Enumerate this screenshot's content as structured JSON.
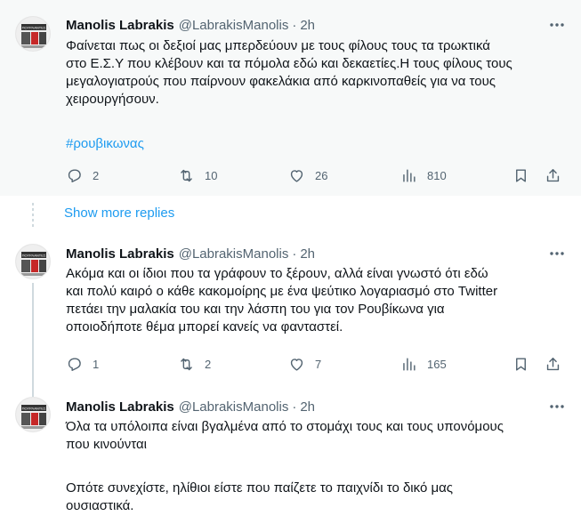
{
  "tweets": [
    {
      "name": "Manolis Labrakis",
      "handle": "@LabrakisManolis",
      "dot": "·",
      "time": "2h",
      "avatar_label": "ΠΟΥΡΛΑΝΤΕΣ",
      "text_lines": [
        "Φαίνεται πως οι δεξιοί μας μπερδεύουν με τους φίλους τους τα τρωκτικά",
        "στο Ε.Σ.Υ που κλέβουν και τα πόμολα εδώ και δεκαετίες.Η τους φίλους τους",
        "μεγαλογιατρούς που παίρνουν φακελάκια από καρκινοπαθείς για να τους",
        "χειρουργήσουν."
      ],
      "hashtag": "#ρουβικωνας",
      "replies": "2",
      "retweets": "10",
      "likes": "26",
      "views": "810"
    },
    {
      "name": "Manolis Labrakis",
      "handle": "@LabrakisManolis",
      "dot": "·",
      "time": "2h",
      "avatar_label": "ΠΟΥΡΛΑΝΤΕΣ",
      "text_lines": [
        "Ακόμα και οι ίδιοι που τα γράφουν το ξέρουν, αλλά είναι γνωστό ότι εδώ",
        "και πολύ καιρό ο κάθε κακομοίρης με ένα ψεύτικο λογαριασμό στο Twitter",
        "πετάει την μαλακία του και την λάσπη του για τον Ρουβίκωνα για",
        "οποιοδήποτε θέμα μπορεί κανείς να φανταστεί."
      ],
      "replies": "1",
      "retweets": "2",
      "likes": "7",
      "views": "165"
    },
    {
      "name": "Manolis Labrakis",
      "handle": "@LabrakisManolis",
      "dot": "·",
      "time": "2h",
      "avatar_label": "ΠΟΥΡΛΑΝΤΕΣ",
      "text_lines": [
        "Όλα τα υπόλοιπα είναι βγαλμένα από το στομάχι τους και τους υπονόμους",
        "που κινούνται",
        "",
        "Οπότε συνεχίστε, ηλίθιοι είστε που παίζετε το παιχνίδι το δικό μας",
        "ουσιαστικά."
      ]
    }
  ],
  "show_more_replies": "Show more replies",
  "colors": {
    "accent": "#1d9bf0",
    "secondary_text": "#536471",
    "highlight_bg": "#f7f9f9"
  }
}
